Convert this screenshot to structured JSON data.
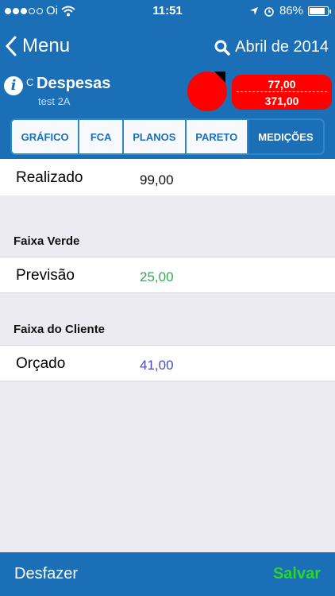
{
  "status_bar": {
    "carrier": "Oi",
    "signal_dots": 3,
    "time": "11:51",
    "battery": "86%"
  },
  "nav": {
    "back_label": "Menu",
    "period": "Abril de 2014"
  },
  "indicator": {
    "tag": "C",
    "title": "Despesas",
    "subtitle": "test 2A",
    "status_color": "#ff0000",
    "value_top": "77,00",
    "value_bottom": "371,00"
  },
  "tabs": [
    {
      "label": "GRÁFICO",
      "active": false
    },
    {
      "label": "FCA",
      "active": false
    },
    {
      "label": "PLANOS",
      "active": false
    },
    {
      "label": "PARETO",
      "active": false
    },
    {
      "label": "MEDIÇÕES",
      "active": true
    }
  ],
  "measurements": {
    "realizado": {
      "label": "Realizado",
      "value": "99,00"
    },
    "faixa_verde": {
      "heading": "Faixa Verde",
      "label": "Previsão",
      "value": "25,00",
      "value_color": "#22b24c"
    },
    "faixa_cliente": {
      "heading": "Faixa do Cliente",
      "label": "Orçado",
      "value": "41,00",
      "value_color": "#4a4ac0"
    }
  },
  "footer": {
    "undo_label": "Desfazer",
    "save_label": "Salvar",
    "save_color": "#2bd52b"
  },
  "colors": {
    "primary": "#1a6fb7",
    "background": "#ebebf1"
  }
}
